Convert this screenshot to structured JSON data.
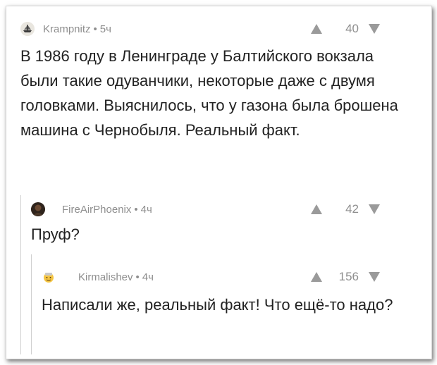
{
  "comments": [
    {
      "author": "Krampnitz",
      "time": "5ч",
      "score": "40",
      "avatar_icon": "ship-avatar-icon",
      "text": "В 1986 году в Ленинграде у Балтийского вокзала были такие одуванчики, некоторые даже с двумя головками. Выяснилось, что у газона была брошена машина с Чернобыля. Реальный факт."
    },
    {
      "author": "FireAirPhoenix",
      "time": "4ч",
      "score": "42",
      "avatar_icon": "dark-photo-avatar-icon",
      "text": "Пруф?"
    },
    {
      "author": "Kirmalishev",
      "time": "4ч",
      "score": "156",
      "avatar_icon": "emoji-avatar-icon",
      "text": "Написали же, реальный факт! Что ещё-то надо?"
    }
  ],
  "separator": "•",
  "colors": {
    "meta": "#8e8e8e",
    "text": "#222222",
    "arrow": "#9a9a9a",
    "thread_line": "#cfcfcf"
  }
}
